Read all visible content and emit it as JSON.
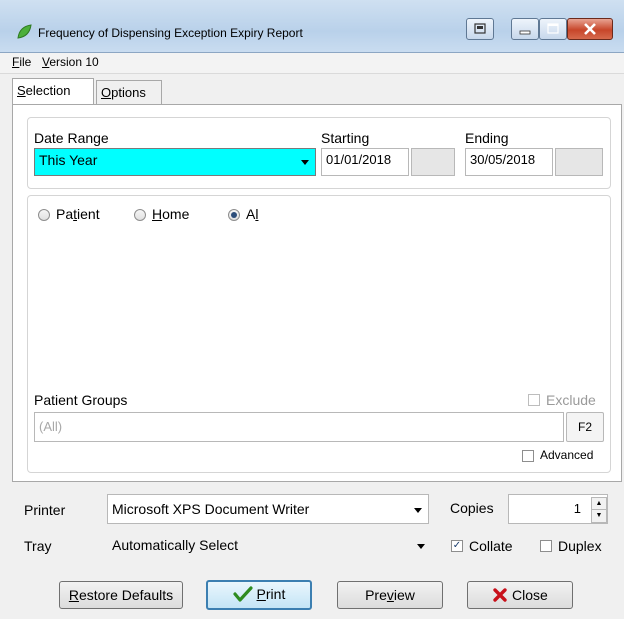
{
  "window": {
    "title": "Frequency of Dispensing Exception Expiry Report"
  },
  "menu": {
    "file_rest": "ile",
    "file_key": "F",
    "version_key": "V",
    "version_rest": "ersion 10"
  },
  "tabs": [
    {
      "key": "S",
      "rest": "election"
    },
    {
      "key": "O",
      "rest": "ptions"
    }
  ],
  "date_range": {
    "label": "Date Range",
    "value": "This Year",
    "starting_label": "Starting",
    "starting_value": "01/01/2018",
    "ending_label": "Ending",
    "ending_value": "30/05/2018"
  },
  "filter": {
    "patient_pre": "Pa",
    "patient_key": "t",
    "patient_post": "ient",
    "home_key": "H",
    "home_rest": "ome",
    "all_pre": "A",
    "all_key": "l",
    "selected": "All"
  },
  "patient_groups": {
    "label": "Patient Groups",
    "exclude_label": "Exclude",
    "value": "(All)",
    "f2_label": "F2",
    "advanced_label": "Advanced"
  },
  "printer": {
    "label": "Printer",
    "value": "Microsoft XPS Document Writer",
    "copies_label": "Copies",
    "copies_value": "1",
    "tray_label": "Tray",
    "tray_value": "Automatically Select",
    "collate_label": "Collate",
    "collate_checked": true,
    "duplex_label": "Duplex",
    "duplex_checked": false
  },
  "buttons": {
    "restore_key": "R",
    "restore_rest": "estore Defaults",
    "print_key": "P",
    "print_rest": "rint",
    "preview_pre": "Pre",
    "preview_key": "v",
    "preview_post": "iew",
    "close_label": "Close"
  },
  "colors": {
    "date_range_highlight": "#00ffff",
    "close_x": "#c8101a",
    "print_check": "#2e8b20"
  }
}
